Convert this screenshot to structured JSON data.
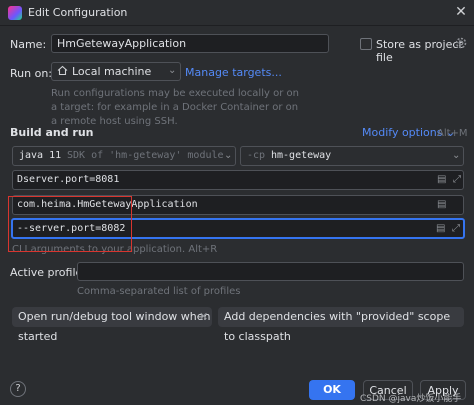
{
  "window": {
    "title": "Edit Configuration",
    "close_glyph": "✕"
  },
  "name": {
    "label": "Name:",
    "value": "HmGetewayApplication"
  },
  "store_as_project": {
    "label": "Store as project file",
    "icon": "gear-icon"
  },
  "run_on": {
    "label": "Run on:",
    "value": "Local machine",
    "manage_link": "Manage targets...",
    "hint": "Run configurations may be executed locally or on a target: for example in a Docker Container or on a remote host using SSH."
  },
  "build_and_run": {
    "heading": "Build and run",
    "modify_options": "Modify options",
    "modify_shortcut": "Alt+M",
    "jdk_version": "java 11",
    "jdk_desc": "SDK of 'hm-geteway' module",
    "cp_prefix": "-cp",
    "cp_value": "hm-geteway",
    "vm_options": "Dserver.port=8081",
    "main_class": "com.heima.HmGetewayApplication",
    "program_args": "--server.port=8082",
    "program_args_hint": "CLI arguments to your application. Alt+R"
  },
  "active_profiles": {
    "label": "Active profiles:",
    "value": "",
    "hint": "Comma-separated list of profiles"
  },
  "chips": [
    {
      "label": "Open run/debug tool window when started"
    },
    {
      "label": "Add dependencies with \"provided\" scope to classpath"
    }
  ],
  "footer": {
    "help": "?",
    "ok": "OK",
    "cancel": "Cancel",
    "apply": "Apply",
    "watermark": "CSDN @java炒饭小能手"
  },
  "colors": {
    "accent": "#3574f0",
    "highlight_box": "#d8352f",
    "link": "#548af7"
  }
}
